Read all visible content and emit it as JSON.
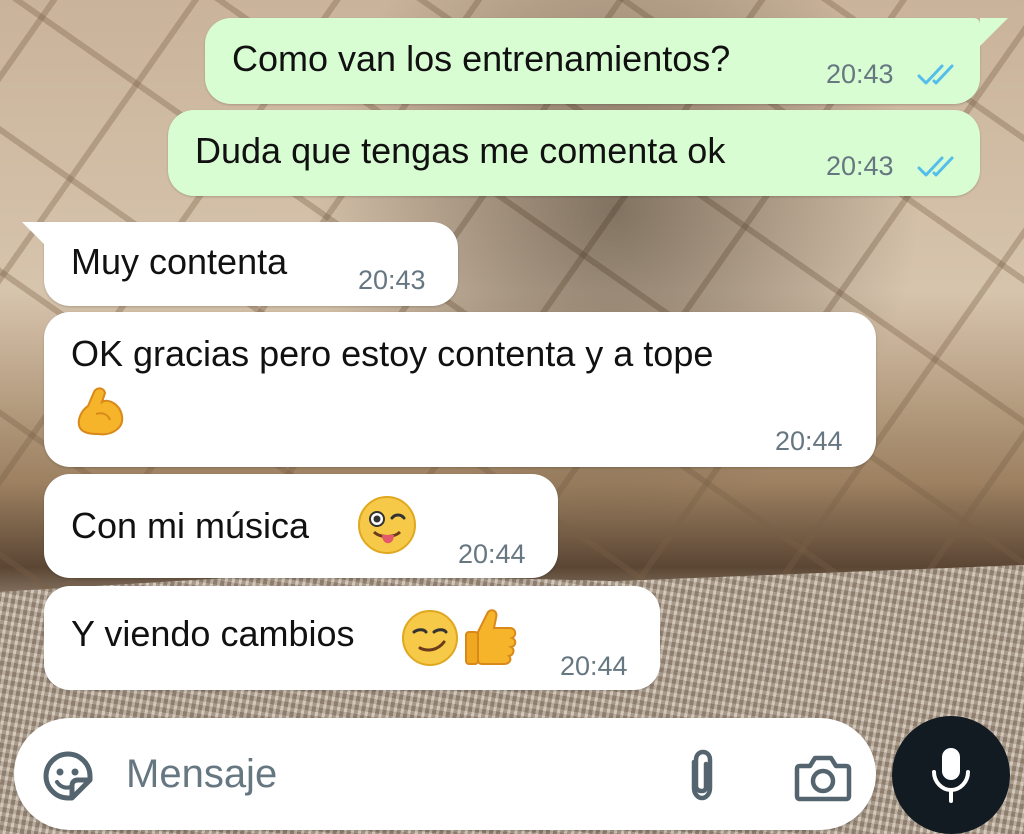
{
  "messages": [
    {
      "direction": "outgoing",
      "text": "Como van los entrenamientos?",
      "time": "20:43",
      "status": "read"
    },
    {
      "direction": "outgoing",
      "text": "Duda que tengas me comenta ok",
      "time": "20:43",
      "status": "read"
    },
    {
      "direction": "incoming",
      "text": "Muy contenta",
      "time": "20:43"
    },
    {
      "direction": "incoming",
      "text": "OK gracias pero estoy contenta y a tope",
      "emoji": "flexed-biceps",
      "time": "20:44"
    },
    {
      "direction": "incoming",
      "text": "Con mi música",
      "emoji": "winking-face-with-tongue",
      "time": "20:44"
    },
    {
      "direction": "incoming",
      "text": "Y viendo cambios",
      "emojis": [
        "smirking-face",
        "thumbs-up"
      ],
      "time": "20:44"
    }
  ],
  "composer": {
    "placeholder": "Mensaje",
    "icons": [
      "sticker-icon",
      "attach-paperclip-icon",
      "camera-icon",
      "microphone-icon"
    ]
  },
  "colors": {
    "outgoing_bubble": "#d9fdd3",
    "incoming_bubble": "#ffffff",
    "read_ticks": "#53bdeb",
    "timestamp": "#667781",
    "mic_button": "#121b22"
  }
}
